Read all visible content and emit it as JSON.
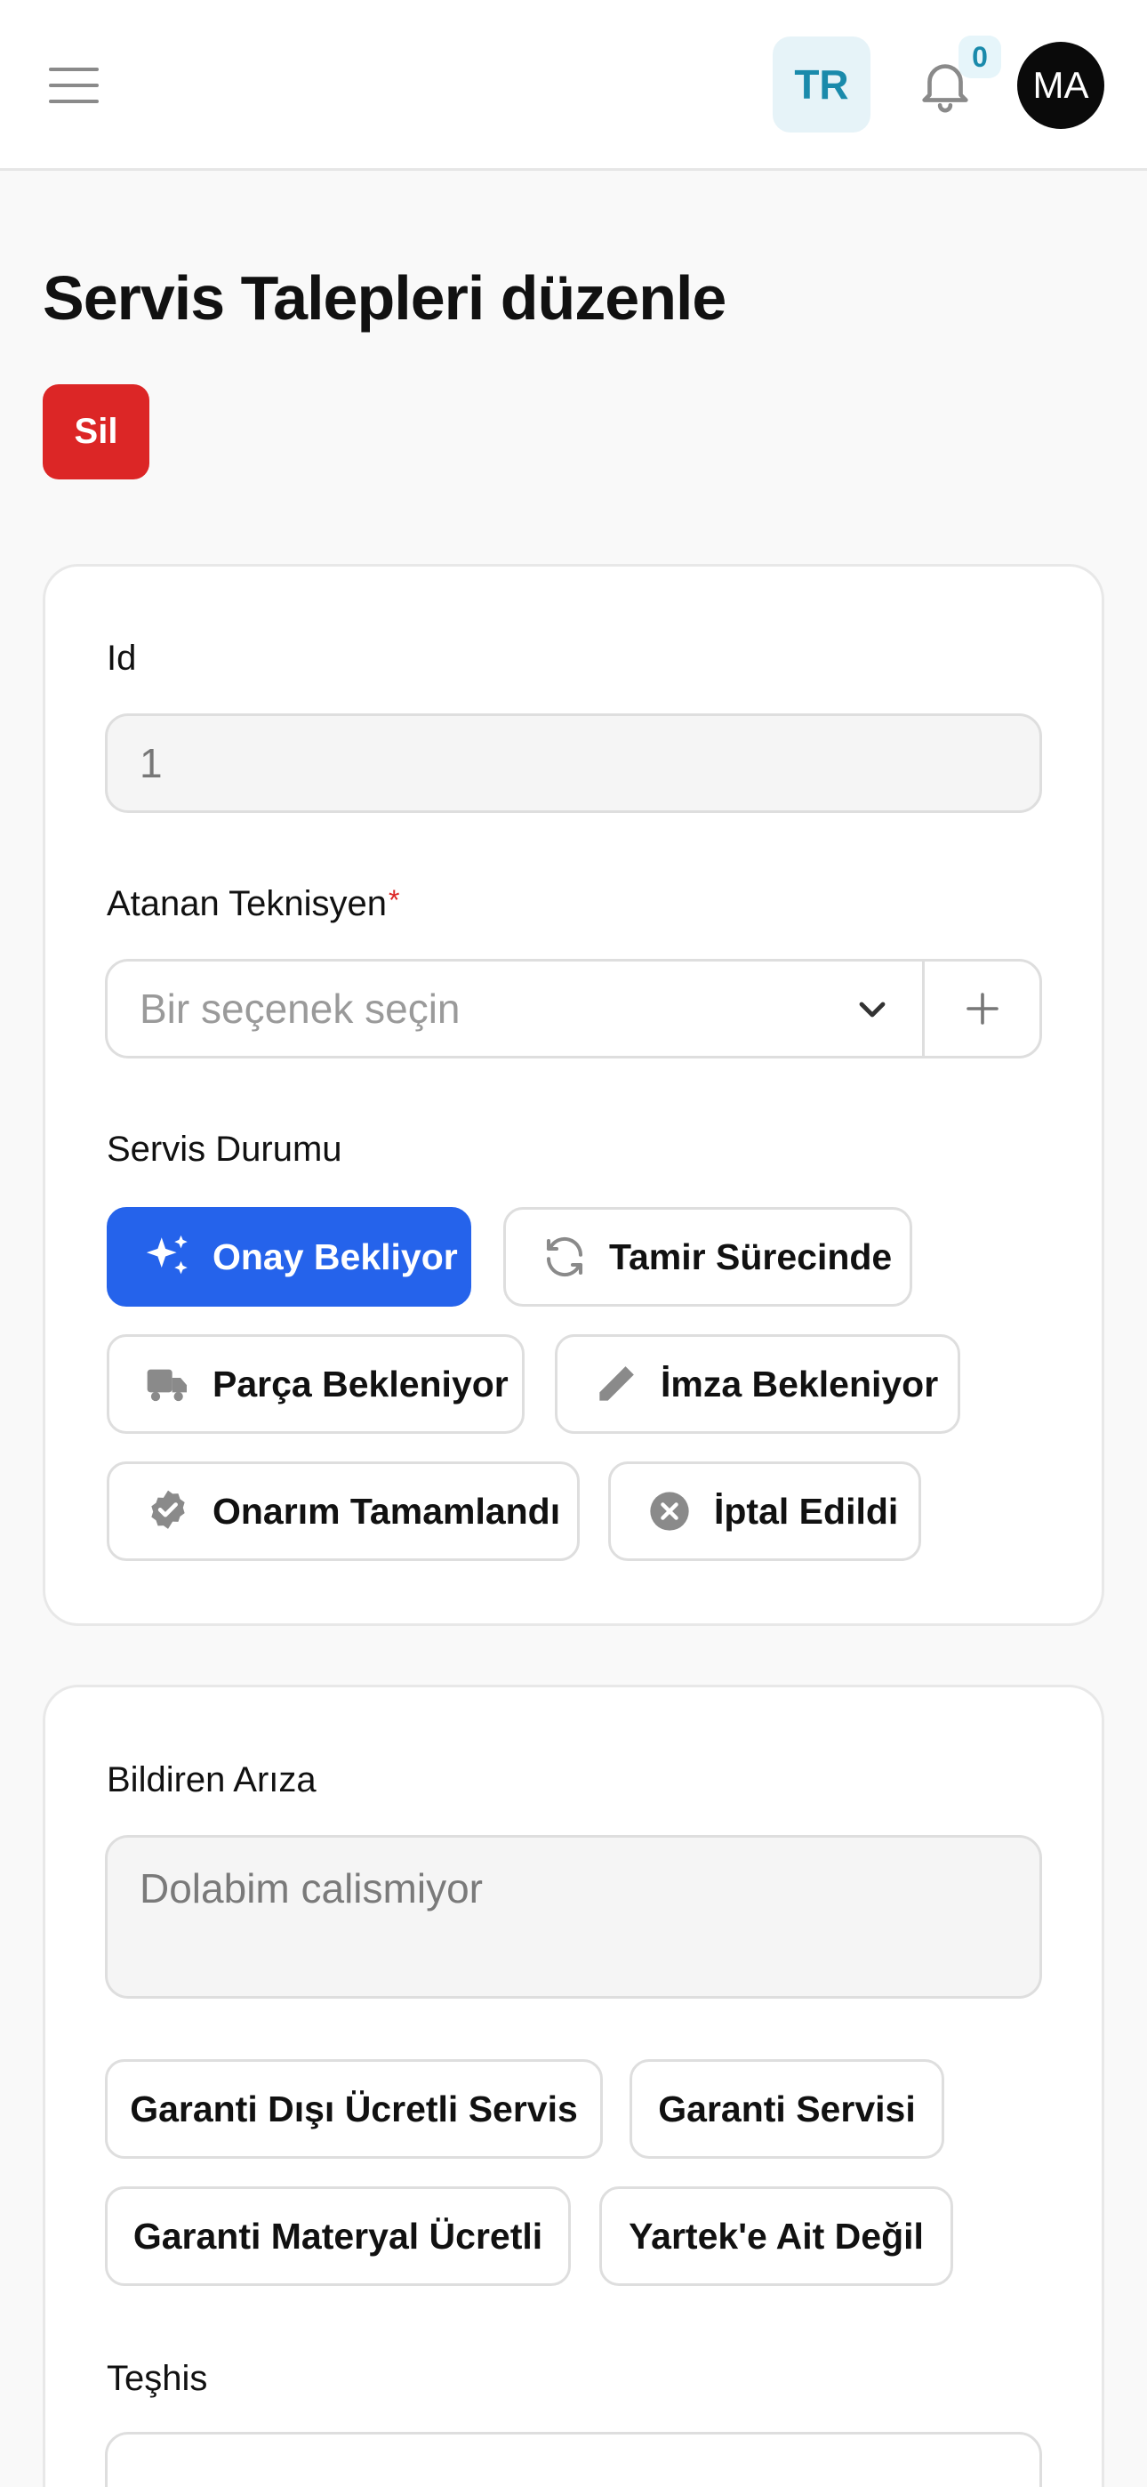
{
  "header": {
    "menu_icon": "hamburger-menu-icon",
    "language": "TR",
    "notifications_icon": "bell-icon",
    "notification_count": "0",
    "user_initials": "MA"
  },
  "page": {
    "title": "Servis Talepleri düzenle",
    "delete_label": "Sil"
  },
  "form": {
    "id_label": "Id",
    "id_value": "1",
    "technician_label": "Atanan Teknisyen",
    "technician_required": "*",
    "technician_placeholder": "Bir seçenek seçin",
    "status_label": "Servis Durumu",
    "status_options": [
      {
        "label": "Onay Bekliyor",
        "icon": "sparkles-icon",
        "selected": true
      },
      {
        "label": "Tamir Sürecinde",
        "icon": "refresh-icon",
        "selected": false
      },
      {
        "label": "Parça Bekleniyor",
        "icon": "truck-icon",
        "selected": false
      },
      {
        "label": "İmza Bekleniyor",
        "icon": "pencil-icon",
        "selected": false
      },
      {
        "label": "Onarım Tamamlandı",
        "icon": "check-badge-icon",
        "selected": false
      },
      {
        "label": "İptal Edildi",
        "icon": "x-circle-icon",
        "selected": false
      }
    ],
    "fault_label": "Bildiren Arıza",
    "fault_value": "Dolabim calismiyor",
    "warranty_options": [
      {
        "label": "Garanti Dışı Ücretli Servis"
      },
      {
        "label": "Garanti Servisi"
      },
      {
        "label": "Garanti Materyal Ücretli"
      },
      {
        "label": "Yartek'e Ait Değil"
      }
    ],
    "diagnosis_label": "Teşhis"
  },
  "colors": {
    "primary": "#2563eb",
    "danger": "#dc2626",
    "accent": "#1a8aab"
  }
}
